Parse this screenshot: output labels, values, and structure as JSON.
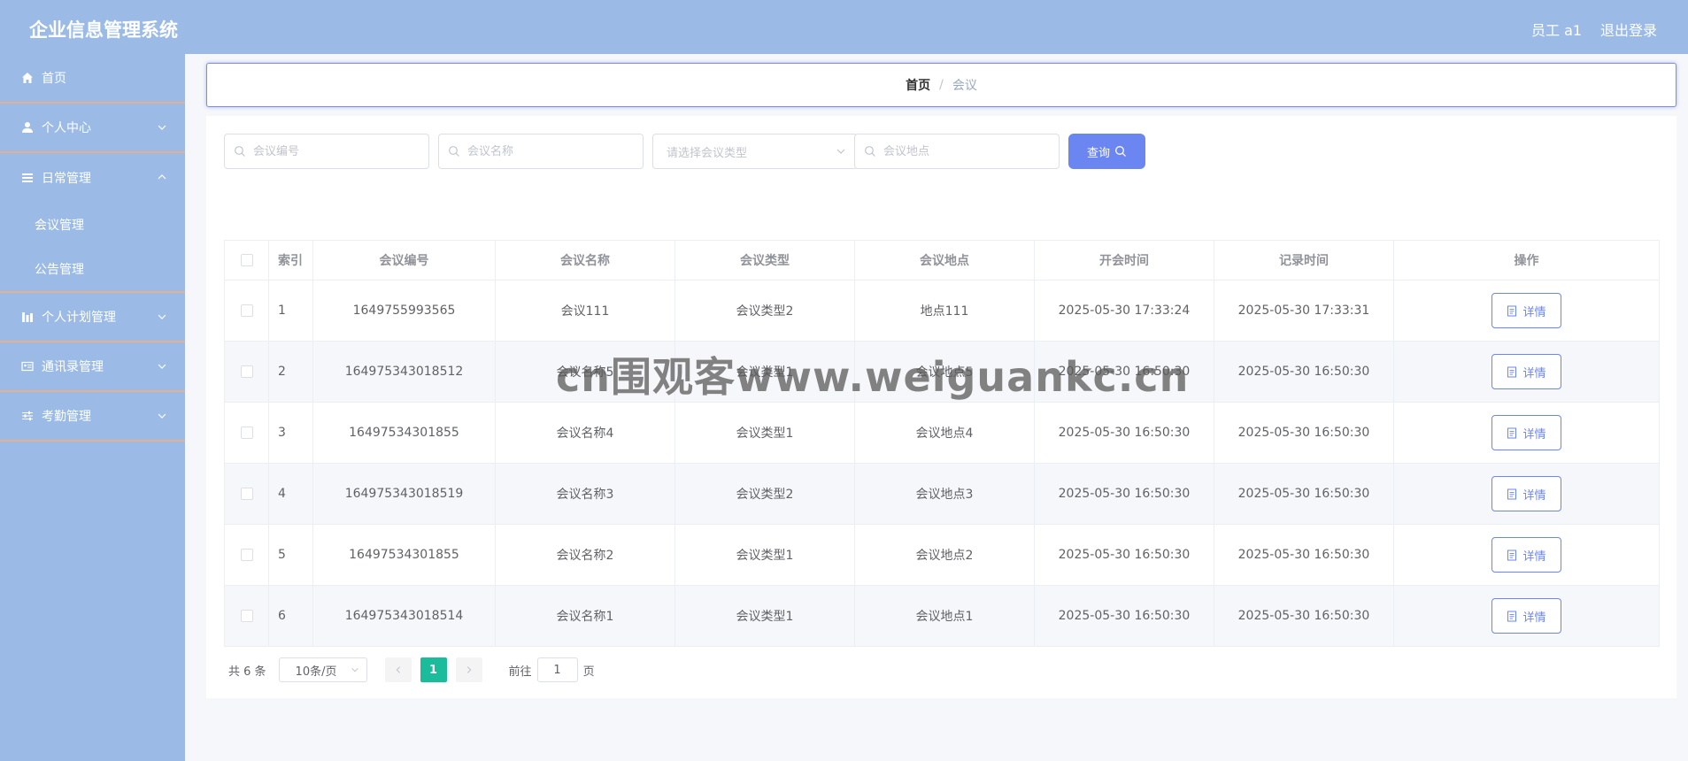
{
  "header": {
    "title": "企业信息管理系统",
    "user": "员工 a1",
    "logout": "退出登录"
  },
  "sidebar": {
    "items": [
      {
        "label": "首页",
        "icon": "home-icon"
      },
      {
        "label": "个人中心",
        "icon": "user-icon"
      },
      {
        "label": "日常管理",
        "icon": "menu-icon",
        "subitems": [
          "会议管理",
          "公告管理"
        ]
      },
      {
        "label": "个人计划管理",
        "icon": "chart-icon"
      },
      {
        "label": "通讯录管理",
        "icon": "contact-card-icon"
      },
      {
        "label": "考勤管理",
        "icon": "sliders-icon"
      }
    ]
  },
  "breadcrumb": {
    "home": "首页",
    "separator": "/",
    "current": "会议"
  },
  "search": {
    "code_placeholder": "会议编号",
    "name_placeholder": "会议名称",
    "type_placeholder": "请选择会议类型",
    "location_placeholder": "会议地点",
    "query_label": "查询"
  },
  "table": {
    "columns": [
      "索引",
      "会议编号",
      "会议名称",
      "会议类型",
      "会议地点",
      "开会时间",
      "记录时间",
      "操作"
    ],
    "detail_label": "详情",
    "rows": [
      {
        "index": "1",
        "code": "1649755993565",
        "name": "会议111",
        "type": "会议类型2",
        "location": "地点111",
        "start": "2025-05-30 17:33:24",
        "record": "2025-05-30 17:33:31"
      },
      {
        "index": "2",
        "code": "164975343018512",
        "name": "会议名称5",
        "type": "会议类型1",
        "location": "会议地点5",
        "start": "2025-05-30 16:50:30",
        "record": "2025-05-30 16:50:30"
      },
      {
        "index": "3",
        "code": "16497534301855",
        "name": "会议名称4",
        "type": "会议类型1",
        "location": "会议地点4",
        "start": "2025-05-30 16:50:30",
        "record": "2025-05-30 16:50:30"
      },
      {
        "index": "4",
        "code": "164975343018519",
        "name": "会议名称3",
        "type": "会议类型2",
        "location": "会议地点3",
        "start": "2025-05-30 16:50:30",
        "record": "2025-05-30 16:50:30"
      },
      {
        "index": "5",
        "code": "16497534301855",
        "name": "会议名称2",
        "type": "会议类型1",
        "location": "会议地点2",
        "start": "2025-05-30 16:50:30",
        "record": "2025-05-30 16:50:30"
      },
      {
        "index": "6",
        "code": "164975343018514",
        "name": "会议名称1",
        "type": "会议类型1",
        "location": "会议地点1",
        "start": "2025-05-30 16:50:30",
        "record": "2025-05-30 16:50:30"
      }
    ]
  },
  "pagination": {
    "total": "共 6 条",
    "page_size": "10条/页",
    "current_page": "1",
    "goto_label": "前往",
    "goto_value": "1",
    "page_unit": "页"
  },
  "watermark": "cn围观客www.weiguankc.cn",
  "colors": {
    "header_bg": "#9bbbe6",
    "sidebar_bg": "#9bbbe6",
    "sidebar_divider": "#e3b18e",
    "primary": "#6b85f1",
    "page_active": "#1abc9c"
  }
}
